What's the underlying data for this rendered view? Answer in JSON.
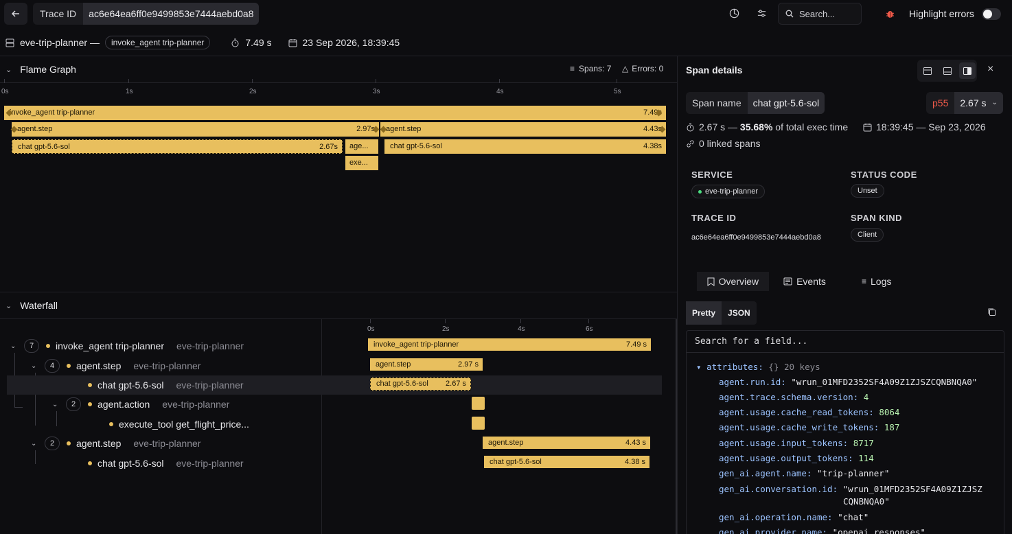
{
  "topbar": {
    "trace_id_label": "Trace ID",
    "trace_id_value": "ac6e64ea6ff0e9499853e7444aebd0a8",
    "search_placeholder": "Search...",
    "highlight_errors_label": "Highlight errors",
    "highlight_errors_on": false
  },
  "summary": {
    "service": "eve-trip-planner —",
    "root_span": "invoke_agent trip-planner",
    "duration": "7.49 s",
    "timestamp": "23 Sep 2026, 18:39:45"
  },
  "flame": {
    "title": "Flame Graph",
    "spans_label": "Spans: 7",
    "errors_label": "Errors: 0",
    "ticks": [
      "0s",
      "1s",
      "2s",
      "3s",
      "4s",
      "5s"
    ],
    "bars": [
      {
        "label": "invoke_agent trip-planner",
        "dur": "7.49s"
      },
      {
        "label": "agent.step",
        "dur": "2.97s"
      },
      {
        "label": "agent.step",
        "dur": "4.43s"
      },
      {
        "label": "chat gpt-5.6-sol",
        "dur": "2.67s"
      },
      {
        "label": "age...",
        "dur": ""
      },
      {
        "label": "chat gpt-5.6-sol",
        "dur": "4.38s"
      },
      {
        "label": "exe...",
        "dur": ""
      }
    ]
  },
  "waterfall": {
    "title": "Waterfall",
    "ticks": [
      "0s",
      "2s",
      "4s",
      "6s"
    ],
    "rows": [
      {
        "count": "7",
        "name": "invoke_agent trip-planner",
        "service": "eve-trip-planner",
        "bar_label": "invoke_agent trip-planner",
        "bar_dur": "7.49 s"
      },
      {
        "count": "4",
        "name": "agent.step",
        "service": "eve-trip-planner",
        "bar_label": "agent.step",
        "bar_dur": "2.97 s"
      },
      {
        "count": "",
        "name": "chat gpt-5.6-sol",
        "service": "eve-trip-planner",
        "bar_label": "chat gpt-5.6-sol",
        "bar_dur": "2.67 s"
      },
      {
        "count": "2",
        "name": "agent.action",
        "service": "eve-trip-planner",
        "bar_label": "",
        "bar_dur": ""
      },
      {
        "count": "",
        "name": "execute_tool get_flight_price...",
        "service": "",
        "bar_label": "",
        "bar_dur": ""
      },
      {
        "count": "2",
        "name": "agent.step",
        "service": "eve-trip-planner",
        "bar_label": "agent.step",
        "bar_dur": "4.43 s"
      },
      {
        "count": "",
        "name": "chat gpt-5.6-sol",
        "service": "eve-trip-planner",
        "bar_label": "chat gpt-5.6-sol",
        "bar_dur": "4.38 s"
      }
    ]
  },
  "details": {
    "title": "Span details",
    "span_name_label": "Span name",
    "span_name_value": "chat gpt-5.6-sol",
    "percentile": "p55",
    "percentile_value": "2.67 s",
    "exec_time_prefix": "2.67 s — ",
    "exec_time_pct": "35.68%",
    "exec_time_suffix": " of total exec time",
    "time_range": "18:39:45 — Sep 23, 2026",
    "linked_spans": "0 linked spans",
    "service_label": "SERVICE",
    "service_value": "eve-trip-planner",
    "status_label": "STATUS CODE",
    "status_value": "Unset",
    "trace_label": "TRACE ID",
    "trace_value": "ac6e64ea6ff0e9499853e7444aebd0a8",
    "kind_label": "SPAN KIND",
    "kind_value": "Client",
    "tabs": [
      "Overview",
      "Events",
      "Logs"
    ],
    "view_modes": [
      "Pretty",
      "JSON"
    ],
    "field_search_placeholder": "Search for a field...",
    "attributes_key": "attributes:",
    "attributes_braces": "{}",
    "attributes_count": "20 keys",
    "attributes": [
      {
        "k": "agent.run.id:",
        "v": "\"wrun_01MFD2352SF4A09Z1ZJSZCQNBNQA0\"",
        "t": "s"
      },
      {
        "k": "agent.trace.schema.version:",
        "v": "4",
        "t": "n"
      },
      {
        "k": "agent.usage.cache_read_tokens:",
        "v": "8064",
        "t": "n"
      },
      {
        "k": "agent.usage.cache_write_tokens:",
        "v": "187",
        "t": "n"
      },
      {
        "k": "agent.usage.input_tokens:",
        "v": "8717",
        "t": "n"
      },
      {
        "k": "agent.usage.output_tokens:",
        "v": "114",
        "t": "n"
      },
      {
        "k": "gen_ai.agent.name:",
        "v": "\"trip-planner\"",
        "t": "s"
      },
      {
        "k": "gen_ai.conversation.id:",
        "v": "\"wrun_01MFD2352SF4A09Z1ZJSZ",
        "t": "s"
      },
      {
        "k": "",
        "v": "CQNBNQA0\"",
        "t": "s"
      },
      {
        "k": "gen_ai.operation.name:",
        "v": "\"chat\"",
        "t": "s"
      },
      {
        "k": "gen_ai.provider.name:",
        "v": "\"openai_responses\"",
        "t": "s"
      }
    ]
  },
  "colors": {
    "bar": "#e8bf5e",
    "accent_red": "#ef5a4a",
    "bg": "#0d0d10"
  }
}
